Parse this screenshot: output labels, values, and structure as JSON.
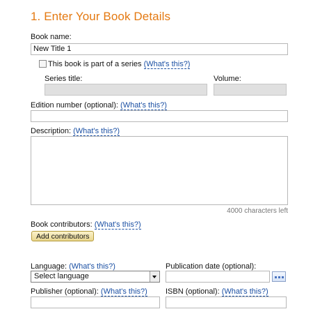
{
  "page": {
    "heading": "1. Enter Your Book Details"
  },
  "book_name": {
    "label": "Book name:",
    "value": "New Title 1"
  },
  "series": {
    "checkbox_label": "This book is part of a series",
    "help_link": "(What's this?)",
    "title_label": "Series title:",
    "volume_label": "Volume:"
  },
  "edition": {
    "label": "Edition number (optional):",
    "help_link": "(What's this?)",
    "value": ""
  },
  "description": {
    "label": "Description:",
    "help_link": "(What's this?)",
    "value": "",
    "counter": "4000 characters left"
  },
  "contributors": {
    "label": "Book contributors:",
    "help_link": "(What's this?)",
    "add_button": "Add contributors"
  },
  "language": {
    "label": "Language:",
    "help_link": "(What's this?)",
    "selected": "Select language"
  },
  "publication_date": {
    "label": "Publication date (optional):",
    "value": "",
    "icon": "calendar-icon"
  },
  "publisher": {
    "label": "Publisher (optional):",
    "help_link": "(What's this?)",
    "value": ""
  },
  "isbn": {
    "label": "ISBN (optional):",
    "help_link": "(What's this?)",
    "value": ""
  },
  "colors": {
    "heading": "#e47911",
    "link": "#1a4fa3"
  }
}
